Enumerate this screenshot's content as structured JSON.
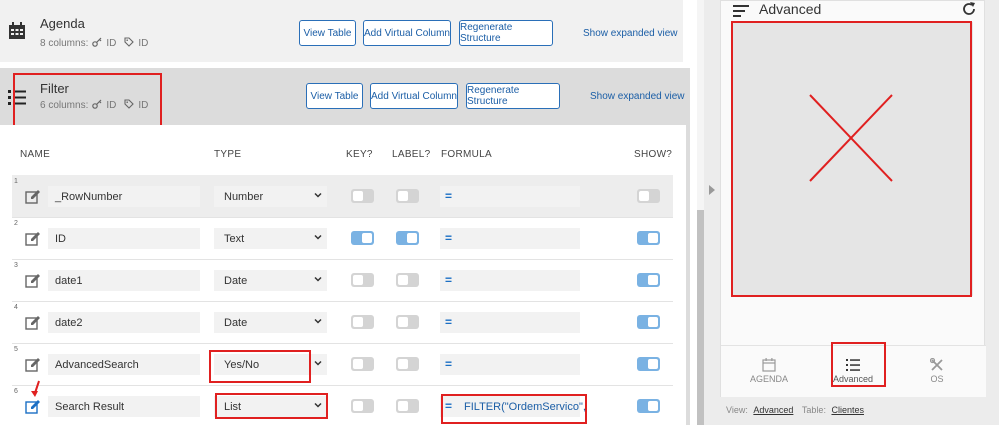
{
  "tables": [
    {
      "name": "Agenda",
      "columns_count": "8 columns:",
      "key_label": "ID",
      "label_label": "ID",
      "view_table": "View Table",
      "add_virtual_column": "Add Virtual Column",
      "regenerate_structure": "Regenerate Structure",
      "show_expanded": "Show expanded view"
    },
    {
      "name": "Filter",
      "columns_count": "6 columns:",
      "key_label": "ID",
      "label_label": "ID",
      "view_table": "View Table",
      "add_virtual_column": "Add Virtual Column",
      "regenerate_structure": "Regenerate Structure",
      "show_expanded": "Show expanded view"
    }
  ],
  "column_headers": {
    "name": "NAME",
    "type": "TYPE",
    "key": "KEY?",
    "label": "LABEL?",
    "formula": "FORMULA",
    "show": "SHOW?"
  },
  "rows": [
    {
      "num": "1",
      "name": "_RowNumber",
      "type": "Number",
      "key": false,
      "label": false,
      "formula": "",
      "show": false
    },
    {
      "num": "2",
      "name": "ID",
      "type": "Text",
      "key": true,
      "label": true,
      "formula": "",
      "show": true
    },
    {
      "num": "3",
      "name": "date1",
      "type": "Date",
      "key": false,
      "label": false,
      "formula": "",
      "show": true
    },
    {
      "num": "4",
      "name": "date2",
      "type": "Date",
      "key": false,
      "label": false,
      "formula": "",
      "show": true
    },
    {
      "num": "5",
      "name": "AdvancedSearch",
      "type": "Yes/No",
      "key": false,
      "label": false,
      "formula": "",
      "show": true
    },
    {
      "num": "6",
      "name": "Search Result",
      "type": "List",
      "key": false,
      "label": false,
      "formula": "FILTER(\"OrdemServico\",",
      "show": true
    }
  ],
  "formula_eq": "=",
  "preview": {
    "title": "Advanced",
    "nav": [
      {
        "label": "AGENDA",
        "icon": "calendar-icon"
      },
      {
        "label": "Advanced",
        "icon": "list-icon"
      },
      {
        "label": "OS",
        "icon": "tools-icon"
      }
    ],
    "footer_view_label": "View:",
    "footer_view_value": "Advanced",
    "footer_table_label": "Table:",
    "footer_table_value": "Clientes"
  },
  "colors": {
    "accent": "#1b5ea6",
    "toggle_on": "#7ab2e3",
    "highlight": "#e02020"
  }
}
